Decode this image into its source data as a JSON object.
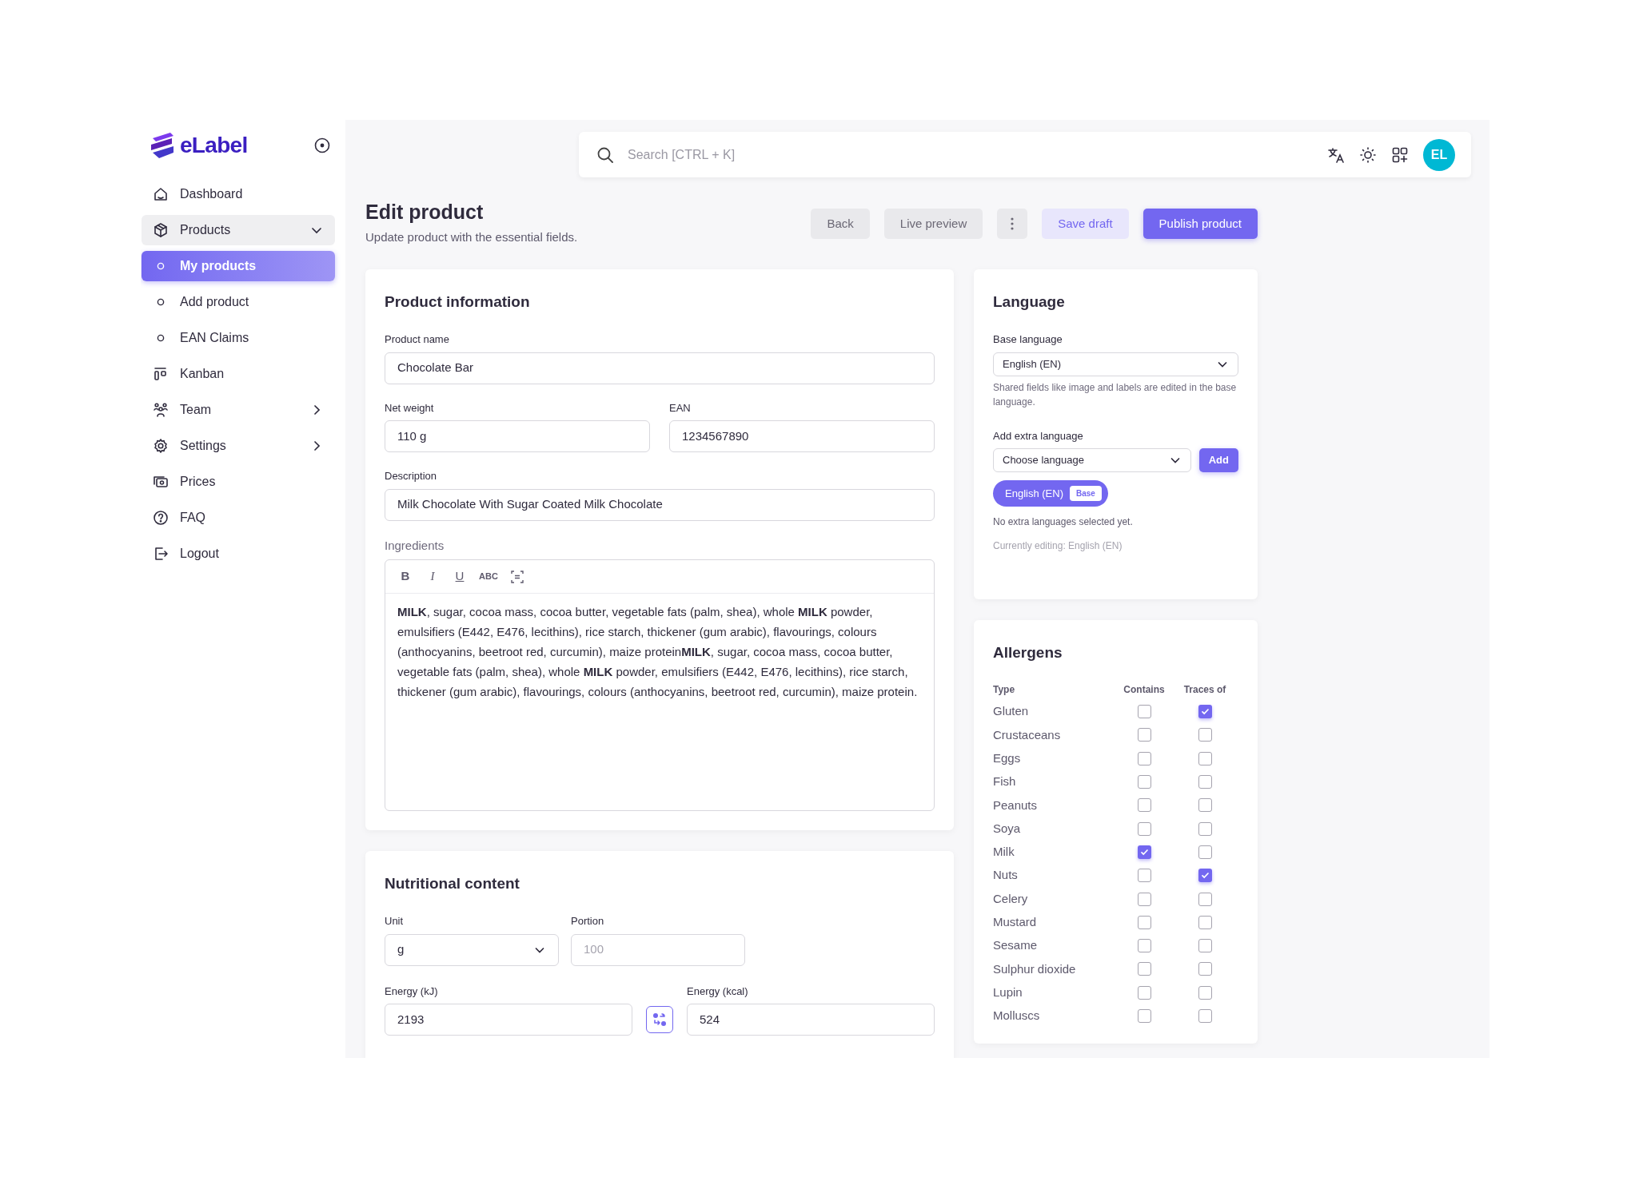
{
  "brand": {
    "name": "eLabel"
  },
  "sidebar": {
    "items": [
      {
        "label": "Dashboard",
        "kind": "main",
        "selected": false
      },
      {
        "label": "Products",
        "kind": "main",
        "selected": false,
        "expanded": true
      },
      {
        "label": "My products",
        "kind": "sub",
        "selected": true
      },
      {
        "label": "Add product",
        "kind": "sub",
        "selected": false
      },
      {
        "label": "EAN Claims",
        "kind": "sub",
        "selected": false
      },
      {
        "label": "Kanban",
        "kind": "main",
        "selected": false
      },
      {
        "label": "Team",
        "kind": "main",
        "selected": false,
        "expanded": false
      },
      {
        "label": "Settings",
        "kind": "main",
        "selected": false,
        "expanded": false
      },
      {
        "label": "Prices",
        "kind": "main",
        "selected": false
      },
      {
        "label": "FAQ",
        "kind": "main",
        "selected": false
      },
      {
        "label": "Logout",
        "kind": "main",
        "selected": false
      }
    ]
  },
  "top_bar": {
    "search": {
      "placeholder": "Search [CTRL + K]"
    },
    "avatar": "EL"
  },
  "header": {
    "title": "Edit product",
    "subtitle": "Update product with the essential fields.",
    "buttons": [
      {
        "label": "Back",
        "kind": "secondary"
      },
      {
        "label": "Live preview",
        "kind": "secondary"
      },
      {
        "kind": "more"
      },
      {
        "label": "Save draft",
        "kind": "soft"
      },
      {
        "label": "Publish product",
        "kind": "primary"
      }
    ]
  },
  "product_information": {
    "title": "Product information",
    "product_name": {
      "label": "Product name",
      "value": "Chocolate Bar"
    },
    "net_weight": {
      "label": "Net weight",
      "value": "110 g"
    },
    "ean": {
      "label": "EAN",
      "value": "1234567890"
    },
    "description": {
      "label": "Description",
      "value": "Milk Chocolate With Sugar Coated Milk Chocolate"
    },
    "ingredients": {
      "label": "Ingredients",
      "toolbar": [
        {
          "label": "B",
          "kind": "bold"
        },
        {
          "label": "I",
          "kind": "italic"
        },
        {
          "label": "U",
          "kind": "underline"
        },
        {
          "label": "ABC",
          "kind": "caps"
        },
        {
          "kind": "icon"
        }
      ],
      "content": "**MILK**, sugar, cocoa mass, cocoa butter, vegetable fats (palm, shea), whole **MILK** powder, emulsifiers (E442, E476, lecithins), rice starch, thickener (gum arabic), flavourings, colours (anthocyanins, beetroot red, curcumin), maize protein**MILK**, sugar, cocoa mass, cocoa butter, vegetable fats (palm, shea), whole **MILK** powder, emulsifiers (E442, E476, lecithins), rice starch, thickener (gum arabic), flavourings, colours (anthocyanins, beetroot red, curcumin), maize protein."
    }
  },
  "language": {
    "title": "Language",
    "base_language": {
      "label": "Base language",
      "value": "English (EN)",
      "hint": "Shared fields like image and labels are edited in the base language."
    },
    "extra_language": {
      "label": "Add extra language",
      "placeholder": "Choose language",
      "button": "Add"
    },
    "chips": [
      {
        "label": "English (EN)",
        "badge": "Base"
      }
    ],
    "empty_note": "No extra languages selected yet.",
    "current_note": "Currently editing: English (EN)"
  },
  "allergens": {
    "title": "Allergens",
    "columns": [
      "Type",
      "Contains",
      "Traces of"
    ],
    "rows": [
      {
        "name": "Gluten",
        "contains": false,
        "traces": true
      },
      {
        "name": "Crustaceans",
        "contains": false,
        "traces": false
      },
      {
        "name": "Eggs",
        "contains": false,
        "traces": false
      },
      {
        "name": "Fish",
        "contains": false,
        "traces": false
      },
      {
        "name": "Peanuts",
        "contains": false,
        "traces": false
      },
      {
        "name": "Soya",
        "contains": false,
        "traces": false
      },
      {
        "name": "Milk",
        "contains": true,
        "traces": false
      },
      {
        "name": "Nuts",
        "contains": false,
        "traces": true
      },
      {
        "name": "Celery",
        "contains": false,
        "traces": false
      },
      {
        "name": "Mustard",
        "contains": false,
        "traces": false
      },
      {
        "name": "Sesame",
        "contains": false,
        "traces": false
      },
      {
        "name": "Sulphur dioxide",
        "contains": false,
        "traces": false
      },
      {
        "name": "Lupin",
        "contains": false,
        "traces": false
      },
      {
        "name": "Molluscs",
        "contains": false,
        "traces": false
      }
    ]
  },
  "nutritional_content": {
    "title": "Nutritional content",
    "unit": {
      "label": "Unit",
      "value": "g"
    },
    "portion": {
      "label": "Portion",
      "placeholder": "100"
    },
    "energy_kj": {
      "label": "Energy (kJ)",
      "value": "2193"
    },
    "energy_kcal": {
      "label": "Energy (kcal)",
      "value": "524"
    }
  }
}
